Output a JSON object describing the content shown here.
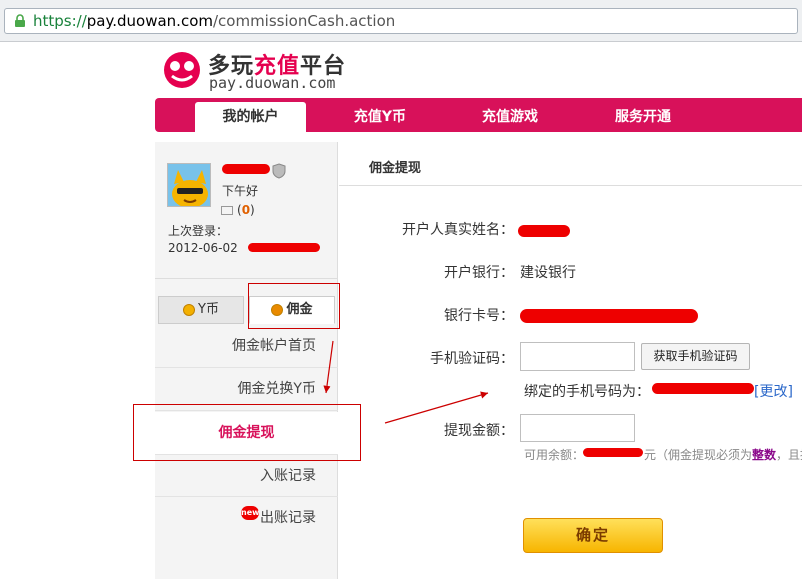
{
  "browser": {
    "url_protocol": "https://",
    "url_host": "pay.duowan.com",
    "url_path": "/commissionCash.action"
  },
  "logo": {
    "name_part1": "多玩",
    "name_part2": "充值",
    "name_part3": "平台",
    "domain": "pay.duowan.com"
  },
  "nav": {
    "items": [
      {
        "label": "我的帐户"
      },
      {
        "label": "充值Y币"
      },
      {
        "label": "充值游戏"
      },
      {
        "label": "服务开通"
      }
    ]
  },
  "user": {
    "greeting": "下午好",
    "mail_count_open": "(",
    "mail_count": "0",
    "mail_count_close": ")",
    "last_login_label": "上次登录：",
    "last_login_date": "2012-06-02"
  },
  "tabs": [
    {
      "label": "Y币"
    },
    {
      "label": "佣金"
    }
  ],
  "menu": {
    "items": [
      {
        "label": "佣金帐户首页"
      },
      {
        "label": "佣金兑换Y币"
      },
      {
        "label": "佣金提现"
      },
      {
        "label": "入账记录"
      },
      {
        "label": "出账记录"
      }
    ],
    "new_badge": "new"
  },
  "main": {
    "title": "佣金提现",
    "fields": {
      "name_label": "开户人真实姓名：",
      "bank_label": "开户银行：",
      "bank_value": "建设银行",
      "card_label": "银行卡号：",
      "sms_label": "手机验证码：",
      "sms_button": "获取手机验证码",
      "bound_text": "绑定的手机号码为：",
      "bound_change": "[更改]",
      "amount_label": "提现金额：",
      "avail_text": "可用余额：",
      "avail_note_pre": "元（佣金提现必须为",
      "avail_note_hl": "整数",
      "avail_note_post": "，且提"
    },
    "confirm_button": "确定"
  },
  "colors": {
    "brand": "#d8115a",
    "redaction": "#ee0000",
    "annotation": "#cc0000"
  }
}
